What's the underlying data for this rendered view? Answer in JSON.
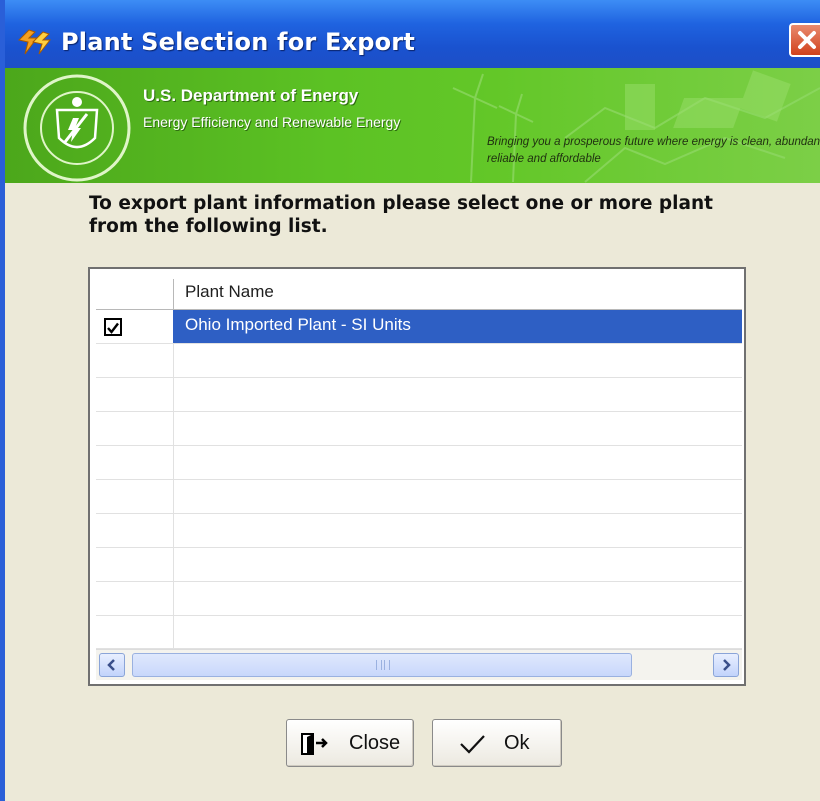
{
  "window": {
    "title": "Plant Selection for Export",
    "icon": "app-lightning-icon",
    "close_icon": "close-x-icon",
    "accent_color": "#1f63e0"
  },
  "banner": {
    "seal_icon": "doe-seal-icon",
    "organization": "U.S. Department of Energy",
    "office": "Energy Efficiency and Renewable Energy",
    "tagline": "Bringing you a prosperous future where energy is clean, abundant, reliable and affordable",
    "background_color": "#5cc224"
  },
  "instructions": "To export plant information please select one or more plant from the following list.",
  "plant_list": {
    "columns": [
      "",
      "Plant Name"
    ],
    "rows": [
      {
        "checked": true,
        "plant_name": "Ohio Imported Plant - SI Units",
        "selected": true
      }
    ],
    "selection_color": "#2e5fc4"
  },
  "scrollbar": {
    "left_icon": "scroll-left-icon",
    "right_icon": "scroll-right-icon"
  },
  "buttons": {
    "close_label": "Close",
    "close_icon": "exit-door-icon",
    "ok_label": "Ok",
    "ok_icon": "checkmark-icon"
  }
}
